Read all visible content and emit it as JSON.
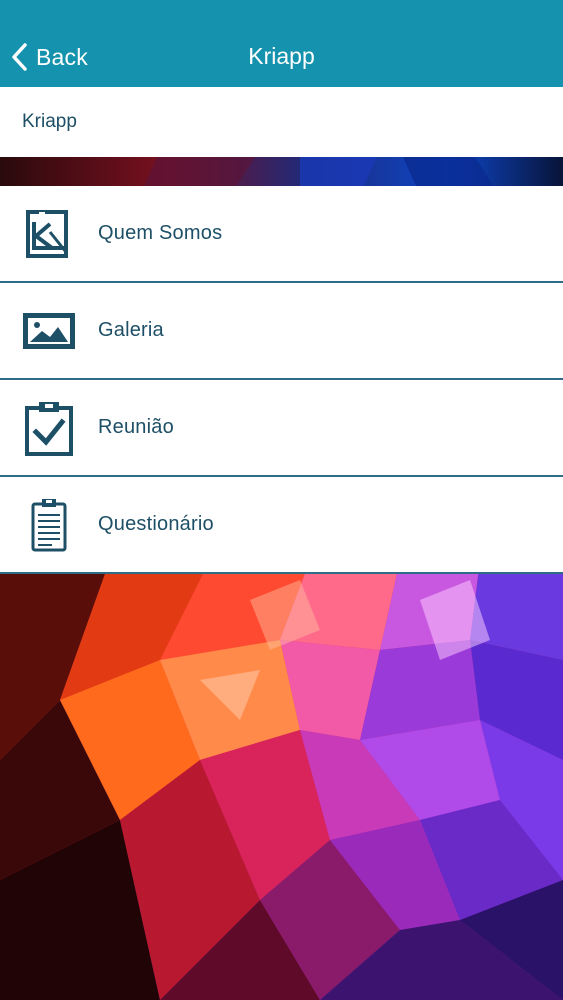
{
  "navbar": {
    "back_label": "Back",
    "title": "Kriapp",
    "background": "#1592ad"
  },
  "subheader": {
    "label": "Kriapp"
  },
  "menu": {
    "items": [
      {
        "label": "Quem Somos",
        "icon": "kriapp-logo-icon"
      },
      {
        "label": "Galeria",
        "icon": "image-gallery-icon"
      },
      {
        "label": "Reunião",
        "icon": "clipboard-check-icon"
      },
      {
        "label": "Questionário",
        "icon": "clipboard-list-icon"
      }
    ],
    "text_color": "#1d4f66",
    "icon_color": "#1d4f66",
    "divider_color": "#2f6d86"
  }
}
